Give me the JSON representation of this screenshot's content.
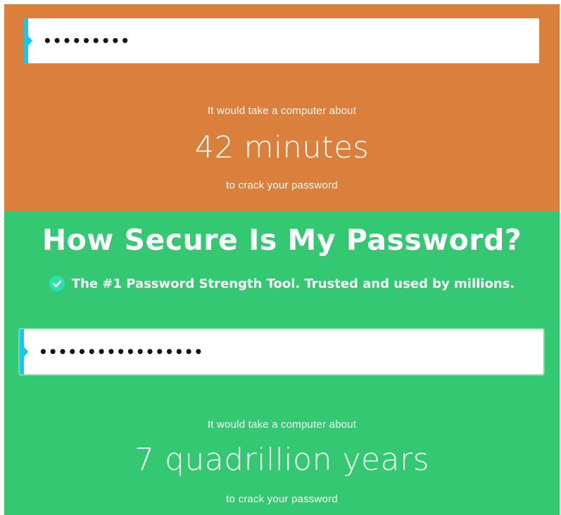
{
  "theme": {
    "weak_color": "#da7f3c",
    "strong_color": "#35c873",
    "accent_color": "#18c6f0",
    "check_color": "#2ee0b0"
  },
  "weak_result": {
    "password_mask": "•••••••••",
    "prefix": "It would take a computer about",
    "duration": "42 minutes",
    "suffix": "to crack your password"
  },
  "strong_result": {
    "title": "How Secure Is My Password?",
    "tagline": "The #1 Password Strength Tool. Trusted and used by millions.",
    "tagline_icon": "check-circle-icon",
    "password_mask": "•••••••••••••••••",
    "prefix": "It would take a computer about",
    "duration": "7 quadrillion years",
    "suffix": "to crack your password"
  }
}
